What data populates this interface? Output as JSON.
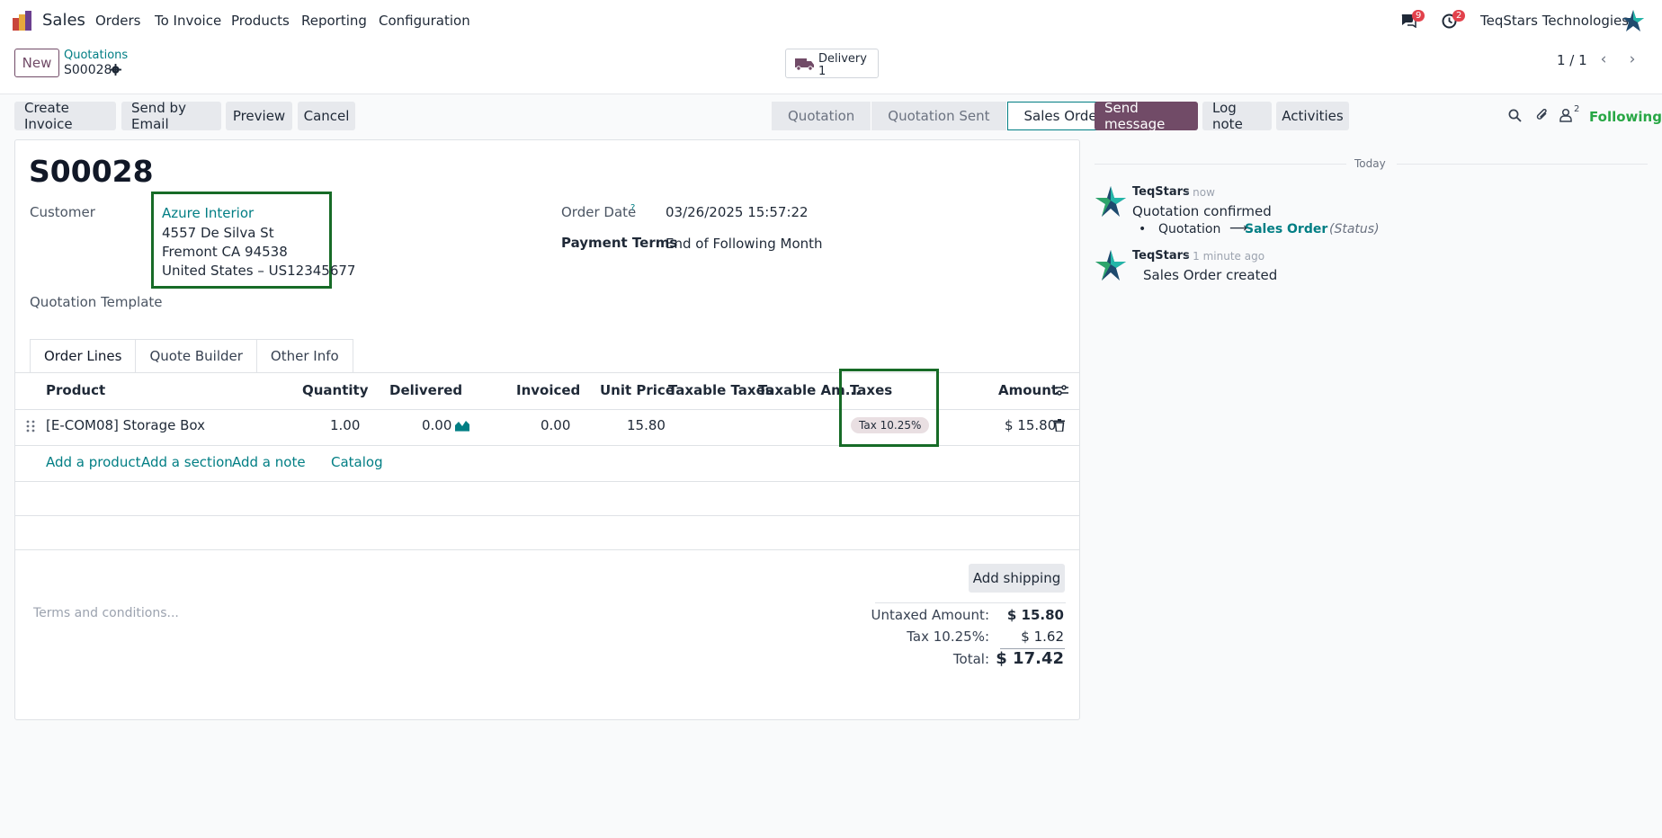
{
  "nav": {
    "app_name": "Sales",
    "items": [
      "Orders",
      "To Invoice",
      "Products",
      "Reporting",
      "Configuration"
    ],
    "messages_badge": "9",
    "activities_badge": "2",
    "company": "TeqStars Technologies"
  },
  "control": {
    "new_label": "New",
    "breadcrumb_parent": "Quotations",
    "breadcrumb_current": "S00028",
    "delivery_label": "Delivery",
    "delivery_count": "1",
    "pager": "1 / 1"
  },
  "actions": {
    "create_invoice": "Create Invoice",
    "send_email": "Send by Email",
    "preview": "Preview",
    "cancel": "Cancel"
  },
  "statusbar": {
    "steps": [
      "Quotation",
      "Quotation Sent",
      "Sales Order"
    ],
    "active": "Sales Order"
  },
  "form": {
    "title": "S00028",
    "customer_label": "Customer",
    "customer_name": "Azure Interior",
    "address_line1": "4557 De Silva St",
    "address_line2": "Fremont CA 94538",
    "address_line3": "United States – US12345677",
    "template_label": "Quotation Template",
    "order_date_label": "Order Date",
    "order_date_help": "?",
    "order_date": "03/26/2025 15:57:22",
    "payment_terms_label": "Payment Terms",
    "payment_terms": "End of Following Month"
  },
  "tabs": [
    "Order Lines",
    "Quote Builder",
    "Other Info"
  ],
  "table": {
    "headers": {
      "product": "Product",
      "quantity": "Quantity",
      "delivered": "Delivered",
      "invoiced": "Invoiced",
      "unit_price": "Unit Price",
      "taxable_taxes": "Taxable Taxes",
      "taxable_amount": "Taxable Am...",
      "taxes": "Taxes",
      "amount": "Amount"
    },
    "row": {
      "product": "[E-COM08] Storage Box",
      "quantity": "1.00",
      "delivered": "0.00",
      "invoiced": "0.00",
      "unit_price": "15.80",
      "tax": "Tax 10.25%",
      "amount": "$ 15.80"
    },
    "add_product": "Add a product",
    "add_section": "Add a section",
    "add_note": "Add a note",
    "catalog": "Catalog"
  },
  "totals": {
    "add_shipping": "Add shipping",
    "terms_placeholder": "Terms and conditions...",
    "untaxed_label": "Untaxed Amount:",
    "untaxed_value": "$ 15.80",
    "tax_label": "Tax 10.25%:",
    "tax_value": "$ 1.62",
    "total_label": "Total:",
    "total_value": "$ 17.42"
  },
  "chatter": {
    "send_message": "Send message",
    "log_note": "Log note",
    "activities": "Activities",
    "followers_count": "2",
    "following": "Following",
    "today": "Today",
    "msg1_author": "TeqStars",
    "msg1_time": "- now",
    "msg1_text": "Quotation confirmed",
    "msg1_old": "Quotation",
    "msg1_arrow": "⟶",
    "msg1_new": "Sales Order",
    "msg1_field": "(Status)",
    "msg2_author": "TeqStars",
    "msg2_time": "- 1 minute ago",
    "msg2_text": "Sales Order created"
  }
}
